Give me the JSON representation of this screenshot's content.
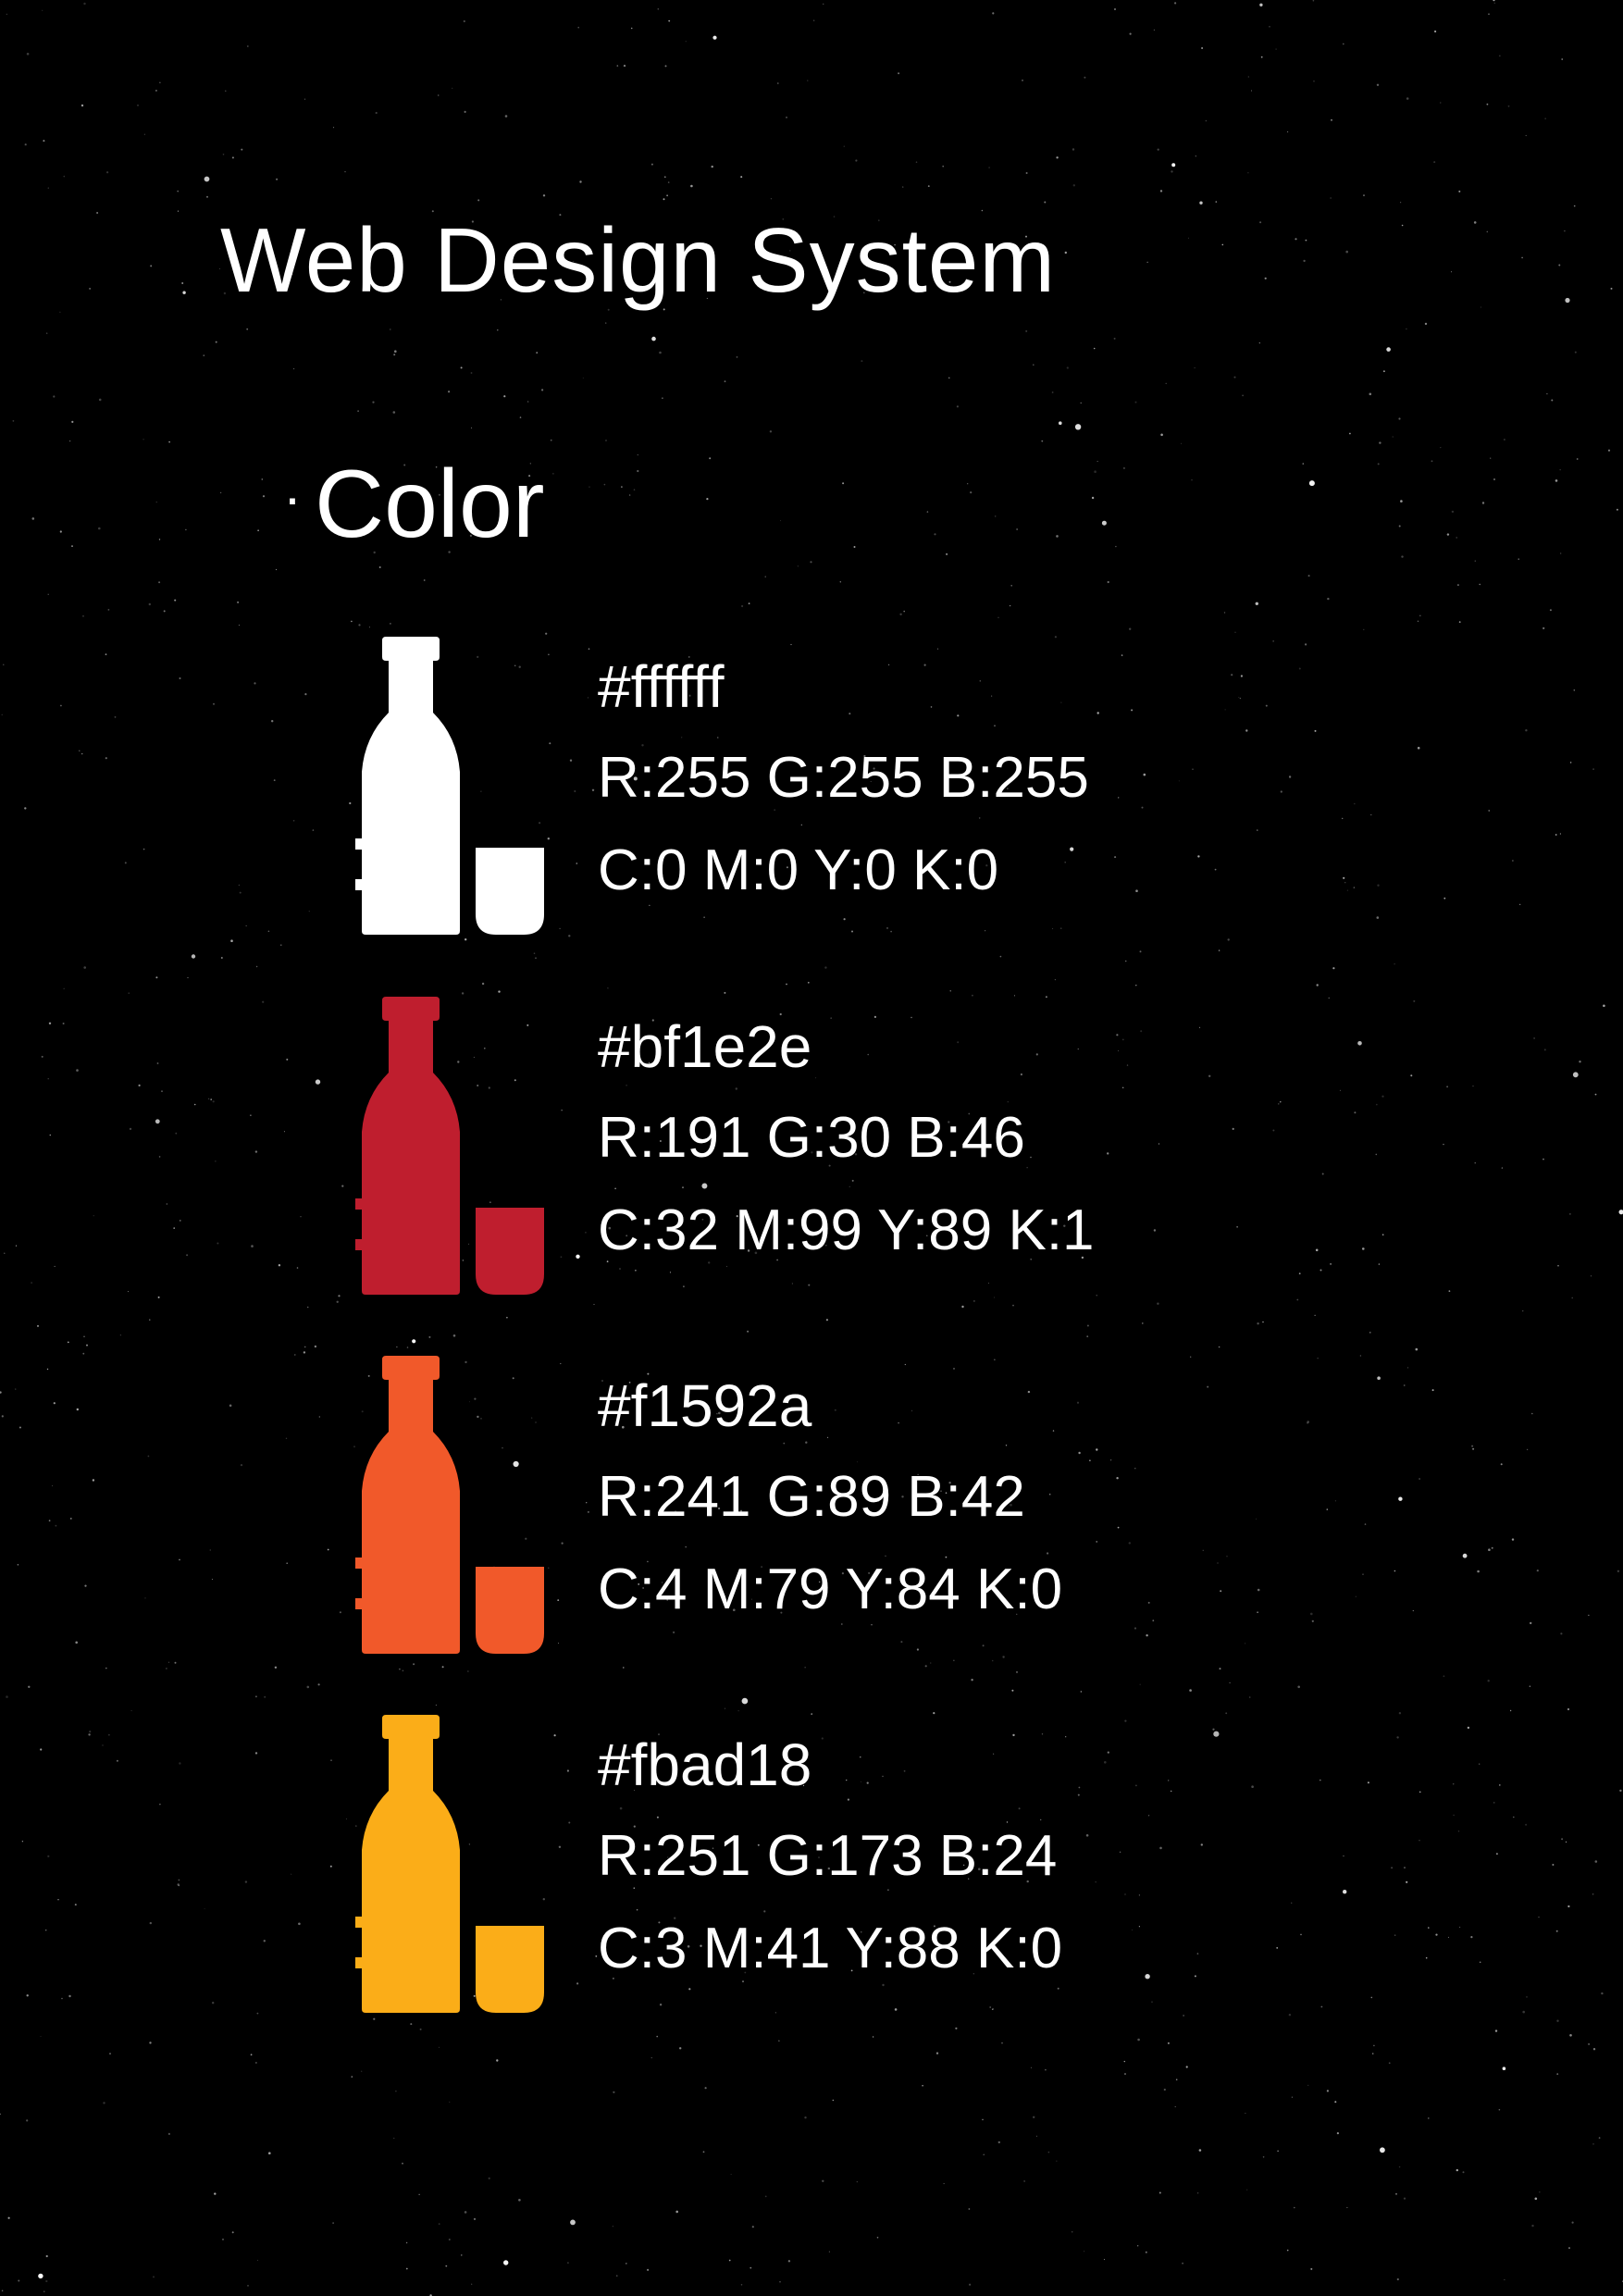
{
  "header": {
    "title": "Web Design System"
  },
  "section": {
    "bullet": "·",
    "heading": "Color"
  },
  "swatches": [
    {
      "hex": "#ffffff",
      "rgb": "R:255 G:255 B:255",
      "cmyk": "C:0 M:0 Y:0 K:0",
      "color": "#ffffff",
      "icon": "bottle-and-glass-icon"
    },
    {
      "hex": "#bf1e2e",
      "rgb": "R:191 G:30 B:46",
      "cmyk": "C:32 M:99 Y:89 K:1",
      "color": "#bf1e2e",
      "icon": "bottle-and-glass-icon"
    },
    {
      "hex": "#f1592a",
      "rgb": "R:241 G:89 B:42",
      "cmyk": "C:4 M:79 Y:84 K:0",
      "color": "#f1592a",
      "icon": "bottle-and-glass-icon"
    },
    {
      "hex": "#fbad18",
      "rgb": "R:251 G:173 B:24",
      "cmyk": "C:3 M:41 Y:88 K:0",
      "color": "#fbad18",
      "icon": "bottle-and-glass-icon"
    }
  ],
  "theme": {
    "background": "#000000",
    "text": "#ffffff"
  }
}
